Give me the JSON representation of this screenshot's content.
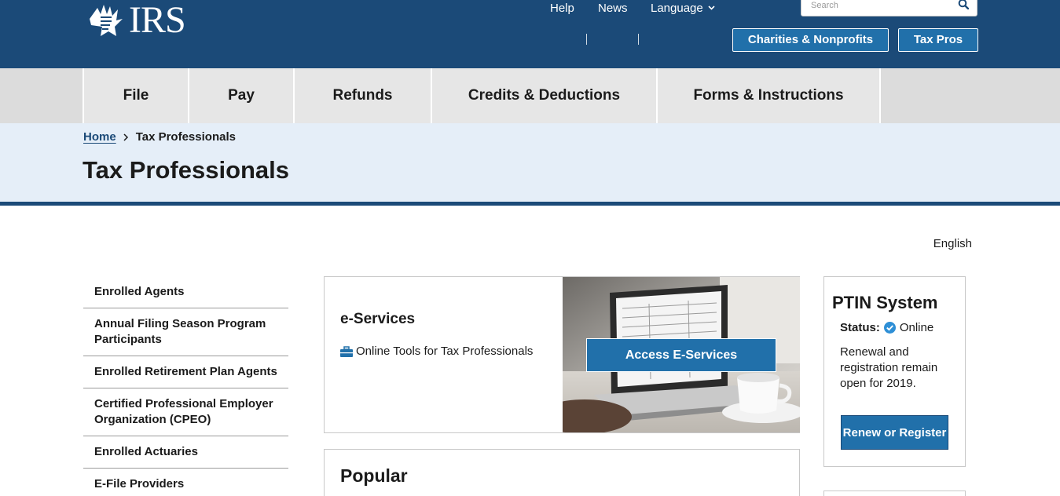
{
  "header": {
    "logo_text": "IRS",
    "search_placeholder": "Search",
    "links": {
      "help": "Help",
      "news": "News",
      "language": "Language"
    },
    "buttons": {
      "charities": "Charities & Nonprofits",
      "tax_pros": "Tax Pros"
    }
  },
  "main_nav": {
    "items": [
      "File",
      "Pay",
      "Refunds",
      "Credits & Deductions",
      "Forms & Instructions"
    ]
  },
  "breadcrumb": {
    "home": "Home",
    "current": "Tax Professionals"
  },
  "page": {
    "title": "Tax Professionals",
    "language_link": "English"
  },
  "sidebar": {
    "items": [
      "Enrolled Agents",
      "Annual Filing Season Program Participants",
      "Enrolled Retirement Plan Agents",
      "Certified Professional Employer Organization (CPEO)",
      "Enrolled Actuaries",
      "E-File Providers"
    ]
  },
  "eservices": {
    "title": "e-Services",
    "tool_link": "Online Tools for Tax Professionals",
    "cta": "Access E-Services"
  },
  "popular": {
    "title": "Popular"
  },
  "ptin": {
    "title": "PTIN System",
    "status_label": "Status:",
    "status_value": "Online",
    "description": "Renewal and registration remain open for 2019.",
    "button": "Renew or Register"
  },
  "colors": {
    "header_bg": "#1b4a78",
    "button_blue": "#2170aa",
    "nav_bg": "#e6e6e6",
    "banner_bg": "#e5eef8"
  }
}
